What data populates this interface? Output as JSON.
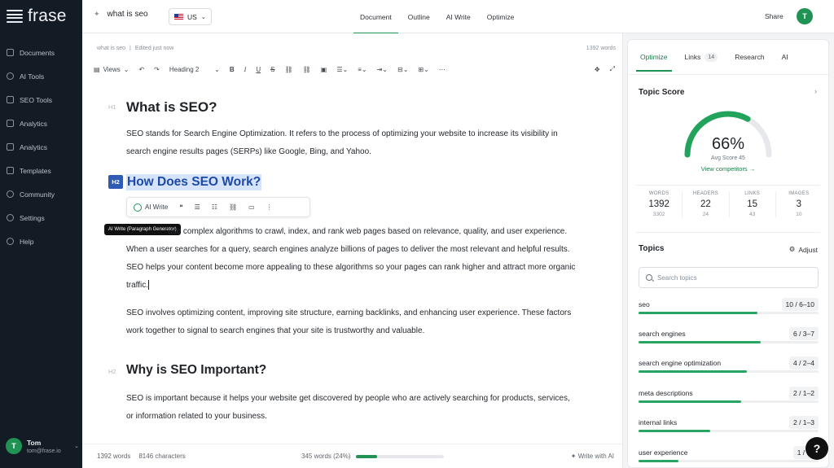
{
  "app": {
    "logo": "frase"
  },
  "sidebar": {
    "items": [
      {
        "label": "Documents"
      },
      {
        "label": "AI Tools"
      },
      {
        "label": "SEO Tools"
      },
      {
        "label": "Analytics"
      },
      {
        "label": "Analytics"
      },
      {
        "label": "Templates"
      },
      {
        "label": "Community"
      },
      {
        "label": "Settings"
      },
      {
        "label": "Help"
      }
    ],
    "user": {
      "initial": "T",
      "name": "Tom",
      "email": "tom@frase.io"
    }
  },
  "topbar": {
    "doc_title": "what is seo",
    "language": "US",
    "tabs": [
      "Document",
      "Outline",
      "AI Write",
      "Optimize"
    ],
    "share": "Share",
    "avatar": "T"
  },
  "editor": {
    "breadcrumb": "what is seo",
    "saved": "Edited just now",
    "word_count": "1392 words",
    "toolbar": {
      "views": "Views",
      "heading": "Heading 2"
    },
    "inline_bar": {
      "ai_write": "AI Write"
    },
    "tooltip": "AI Write (Paragraph Generator)",
    "blocks": [
      {
        "label": "H1",
        "heading": "What is SEO?"
      },
      {
        "text": "SEO stands for Search Engine Optimization. It refers to the process of optimizing your website to increase its visibility in search engine results pages (SERPs) like Google, Bing, and Yahoo."
      },
      {
        "label": "H2",
        "heading": "How Does SEO Work?"
      },
      {
        "text": "use complex algorithms to crawl, index, and rank web pages based on relevance, quality, and user experience. When a user searches for a query, search engines analyze billions of pages to deliver the most relevant and helpful results. SEO helps your content become more appealing to these algorithms so your pages can rank higher and attract more organic traffic."
      },
      {
        "text": "SEO involves optimizing content, improving site structure, earning backlinks, and enhancing user experience. These factors work together to signal to search engines that your site is trustworthy and valuable."
      },
      {
        "label": "H2",
        "heading": "Why is SEO Important?"
      },
      {
        "text": "SEO is important because it helps your website get discovered by people who are actively searching for products, services, or information related to your business."
      }
    ],
    "footer": {
      "words": "1392 words",
      "chars": "8146 characters",
      "progress_text": "345 words (24%)",
      "progress": 0.24,
      "write_ai": "Write with AI"
    }
  },
  "panel": {
    "tabs": [
      {
        "label": "Optimize"
      },
      {
        "label": "Links",
        "count": "14"
      },
      {
        "label": "Research"
      },
      {
        "label": "AI"
      }
    ],
    "score_title": "Topic Score",
    "score": "66%",
    "score_value": 66,
    "avg": "Avg Score 45",
    "view_competitors": "View competitors →",
    "stats": [
      {
        "label": "WORDS",
        "value": "1392",
        "sub": "3302"
      },
      {
        "label": "HEADERS",
        "value": "22",
        "sub": "24"
      },
      {
        "label": "LINKS",
        "value": "15",
        "sub": "43"
      },
      {
        "label": "IMAGES",
        "value": "3",
        "sub": "10"
      }
    ],
    "topics_title": "Topics",
    "adjust": "Adjust",
    "search_placeholder": "Search topics",
    "topics": [
      {
        "name": "seo",
        "count": "10 / 6–10",
        "level": 0.66
      },
      {
        "name": "search engines",
        "count": "6 / 3–7",
        "level": 0.68
      },
      {
        "name": "search engine optimization",
        "count": "4 / 2–4",
        "level": 0.6
      },
      {
        "name": "meta descriptions",
        "count": "2 / 1–2",
        "level": 0.57
      },
      {
        "name": "internal links",
        "count": "2 / 1–3",
        "level": 0.4
      },
      {
        "name": "user experience",
        "count": "1 / 1–",
        "level": 0.22
      }
    ]
  },
  "help": "?"
}
